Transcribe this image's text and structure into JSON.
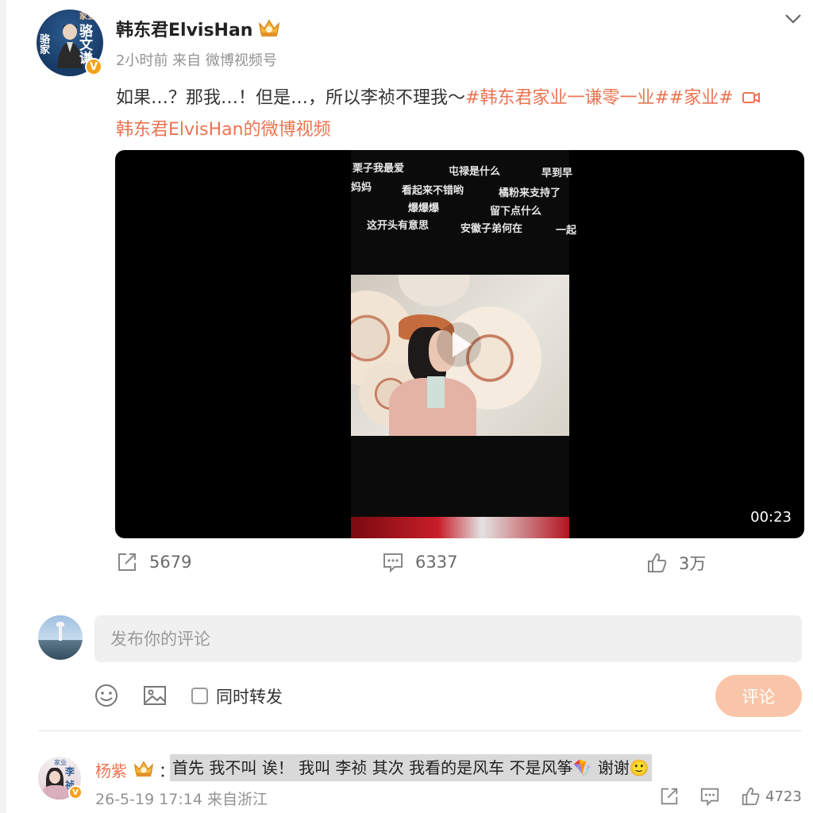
{
  "post": {
    "author": "韩东君ElvisHan",
    "avatar_text": [
      "家业",
      "骆文谦",
      "骆家"
    ],
    "verified_badge": "V",
    "meta": "2小时前  来自 微博视频号",
    "text_plain": "如果…？那我…！但是…，所以李祯不理我～",
    "hashtag1": "#韩东君家业一谦零一业#",
    "hashtag2": "#家业#",
    "video_link": "韩东君ElvisHan的微博视频"
  },
  "video": {
    "duration": "00:23",
    "danmaku": [
      "栗子我最爱",
      "屯禄是什么",
      "早到早",
      "妈妈",
      "看起来不错哟",
      "橘粉来支持了",
      "爆爆爆",
      "留下点什么",
      "这开头有意思",
      "安徽子弟何在",
      "一起"
    ]
  },
  "actions": {
    "repost": "5679",
    "comment": "6337",
    "like": "3万"
  },
  "compose": {
    "placeholder": "发布你的评论",
    "repost_label": "同时转发",
    "submit_label": "评论"
  },
  "comment": {
    "user": "杨紫",
    "colon": "：",
    "text": "首先 我不叫 诶！ 我叫 李祯 其次 我看的是风车 不是风筝🪁 谢谢🙂",
    "meta": "26-5-19 17:14 来自浙江",
    "likes": "4723",
    "avatar_text": [
      "家业",
      "李祯"
    ]
  },
  "colors": {
    "accent": "#eb7350",
    "verified": "#f6a11a",
    "submit_bg": "#f9c5a8"
  },
  "icons": [
    "chevron-down-icon",
    "crown-icon",
    "video-camera-icon",
    "play-icon",
    "repost-icon",
    "comment-icon",
    "like-icon",
    "emoji-icon",
    "image-icon"
  ]
}
